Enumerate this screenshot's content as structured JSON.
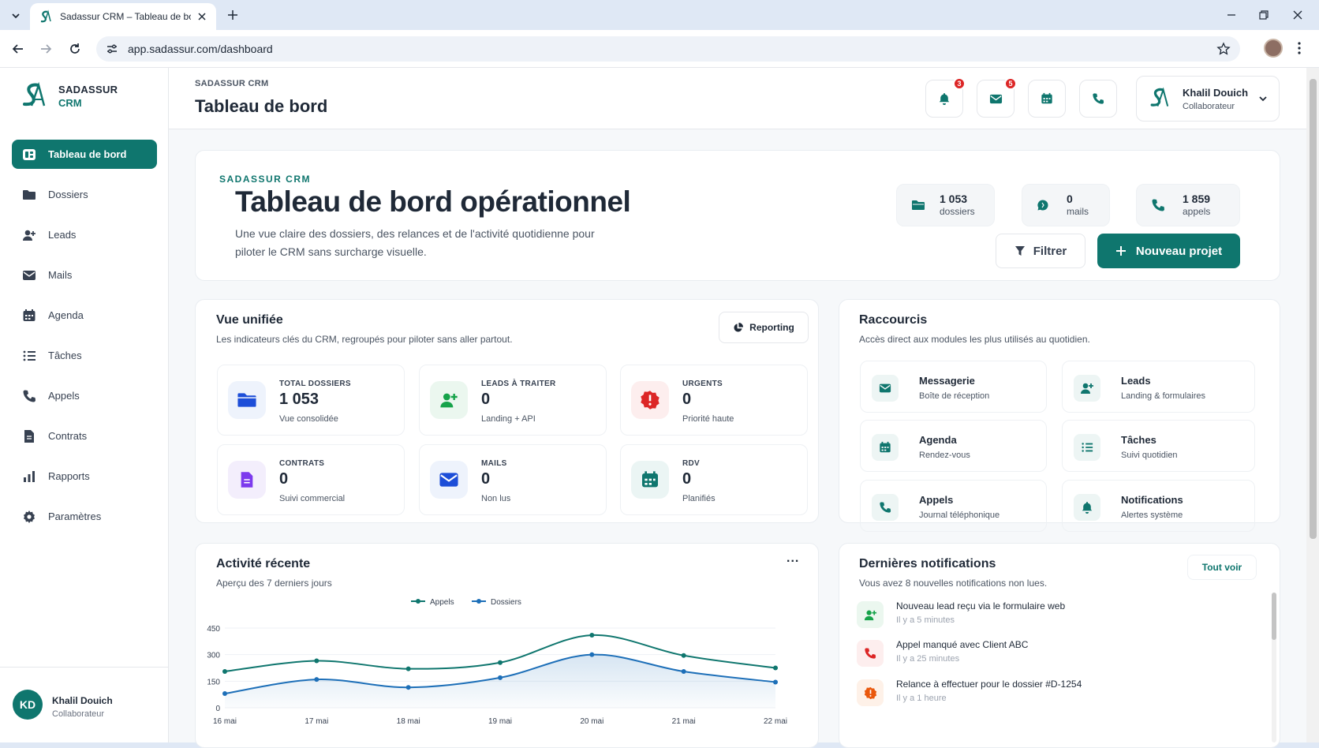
{
  "browser": {
    "tab_title": "Sadassur CRM – Tableau de bord",
    "url": "app.sadassur.com/dashboard"
  },
  "sidebar": {
    "brand_line1": "SADASSUR",
    "brand_line2": "CRM",
    "items": [
      {
        "label": "Tableau de bord",
        "icon": "dashboard-icon",
        "active": true
      },
      {
        "label": "Dossiers",
        "icon": "folder-icon"
      },
      {
        "label": "Leads",
        "icon": "user-plus-icon"
      },
      {
        "label": "Mails",
        "icon": "mail-icon"
      },
      {
        "label": "Agenda",
        "icon": "calendar-icon"
      },
      {
        "label": "Tâches",
        "icon": "list-icon"
      },
      {
        "label": "Appels",
        "icon": "phone-icon"
      },
      {
        "label": "Contrats",
        "icon": "contract-icon"
      },
      {
        "label": "Rapports",
        "icon": "bar-chart-icon"
      },
      {
        "label": "Paramètres",
        "icon": "gear-icon"
      }
    ],
    "user": {
      "initials": "KD",
      "name": "Khalil Douich",
      "role": "Collaborateur"
    }
  },
  "header": {
    "breadcrumb": "SADASSUR CRM",
    "title": "Tableau de bord",
    "notifications_badge": "3",
    "mail_badge": "5",
    "user_name": "Khalil Douich",
    "user_role": "Collaborateur"
  },
  "hero": {
    "eyebrow": "SADASSUR CRM",
    "title": "Tableau de bord opérationnel",
    "description": "Une vue claire des dossiers, des relances et de l'activité quotidienne pour piloter le CRM sans surcharge visuelle.",
    "stats": [
      {
        "value": "1 053",
        "label": "dossiers",
        "icon": "folder-icon"
      },
      {
        "value": "0",
        "label": "mails",
        "icon": "chat-icon"
      },
      {
        "value": "1 859",
        "label": "appels",
        "icon": "phone-icon"
      }
    ],
    "filter_label": "Filtrer",
    "new_project_label": "Nouveau projet"
  },
  "unified": {
    "title": "Vue unifiée",
    "subtitle": "Les indicateurs clés du CRM, regroupés pour piloter sans aller partout.",
    "reporting_label": "Reporting",
    "kpis": [
      {
        "label": "TOTAL DOSSIERS",
        "value": "1 053",
        "sub": "Vue consolidée",
        "icon": "folder-icon",
        "color": "#1d4ed8"
      },
      {
        "label": "LEADS À TRAITER",
        "value": "0",
        "sub": "Landing + API",
        "icon": "user-plus-icon",
        "color": "#16a34a"
      },
      {
        "label": "URGENTS",
        "value": "0",
        "sub": "Priorité haute",
        "icon": "alert-icon",
        "color": "#dc2626"
      },
      {
        "label": "CONTRATS",
        "value": "0",
        "sub": "Suivi commercial",
        "icon": "contract-icon",
        "color": "#7c3aed"
      },
      {
        "label": "MAILS",
        "value": "0",
        "sub": "Non lus",
        "icon": "mail-icon",
        "color": "#1d4ed8"
      },
      {
        "label": "RDV",
        "value": "0",
        "sub": "Planifiés",
        "icon": "calendar-icon",
        "color": "#0f766e"
      }
    ]
  },
  "shortcuts": {
    "title": "Raccourcis",
    "subtitle": "Accès direct aux modules les plus utilisés au quotidien.",
    "items": [
      {
        "title": "Messagerie",
        "sub": "Boîte de réception",
        "icon": "mail-icon"
      },
      {
        "title": "Leads",
        "sub": "Landing & formulaires",
        "icon": "user-plus-icon"
      },
      {
        "title": "Agenda",
        "sub": "Rendez-vous",
        "icon": "calendar-icon"
      },
      {
        "title": "Tâches",
        "sub": "Suivi quotidien",
        "icon": "list-icon"
      },
      {
        "title": "Appels",
        "sub": "Journal téléphonique",
        "icon": "phone-icon"
      },
      {
        "title": "Notifications",
        "sub": "Alertes système",
        "icon": "bell-icon"
      }
    ]
  },
  "activity": {
    "title": "Activité récente",
    "subtitle": "Aperçu des 7 derniers jours",
    "more": "..."
  },
  "chart_data": {
    "type": "line",
    "categories": [
      "16 mai",
      "17 mai",
      "18 mai",
      "19 mai",
      "20 mai",
      "21 mai",
      "22 mai"
    ],
    "series": [
      {
        "name": "Appels",
        "values": [
          205,
          265,
          220,
          255,
          410,
          295,
          225
        ],
        "color": "#0f766e"
      },
      {
        "name": "Dossiers",
        "values": [
          80,
          160,
          115,
          170,
          300,
          205,
          145
        ],
        "color": "#1d6fb8"
      }
    ],
    "ylim": [
      0,
      450
    ],
    "yticks": [
      "0",
      "150",
      "300",
      "450"
    ],
    "legend": "top-center",
    "grid": true
  },
  "notifications": {
    "title": "Dernières notifications",
    "subtitle": "Vous avez 8 nouvelles notifications non lues.",
    "view_all": "Tout voir",
    "items": [
      {
        "text": "Nouveau lead reçu via le formulaire web",
        "time": "Il y a 5 minutes",
        "icon": "user-plus-icon",
        "color": "#16a34a"
      },
      {
        "text": "Appel manqué avec Client ABC",
        "time": "Il y a 25 minutes",
        "icon": "phone-icon",
        "color": "#dc2626"
      },
      {
        "text": "Relance à effectuer pour le dossier #D-1254",
        "time": "Il y a 1 heure",
        "icon": "alert-icon",
        "color": "#ea580c"
      }
    ]
  }
}
